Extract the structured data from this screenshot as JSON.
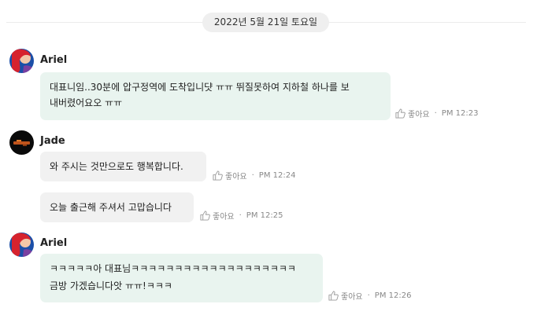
{
  "date_separator": "2022년 5월 21일 토요일",
  "like_label": "좋아요",
  "colors": {
    "bubble_green": "#e9f4ef",
    "bubble_gray": "#f1f1f1",
    "meta_text": "#888888"
  },
  "messages": [
    {
      "sender": "Ariel",
      "avatar": "ariel-avatar",
      "lines": [
        "대표니임..30분에 압구정역에 도착입니댯 ㅠㅠ 뛰질못하여 지하철 하나를 보",
        "내버렸어요오 ㅠㅠ"
      ],
      "time": "PM 12:23"
    },
    {
      "sender": "Jade",
      "avatar": "jade-avatar",
      "lines": [
        "와 주시는 것만으로도 행복합니다."
      ],
      "time": "PM 12:24"
    },
    {
      "sender": "Jade",
      "lines": [
        "오늘 출근해 주셔서 고맙습니다"
      ],
      "time": "PM 12:25"
    },
    {
      "sender": "Ariel",
      "avatar": "ariel-avatar",
      "lines": [
        "ㅋㅋㅋㅋㅋ아 대표님ㅋㅋㅋㅋㅋㅋㅋㅋㅋㅋㅋㅋㅋㅋㅋㅋㅋㅋㅋ",
        "금방 가겠습니다앗 ㅠㅠ!ㅋㅋㅋ"
      ],
      "time": "PM 12:26"
    }
  ]
}
